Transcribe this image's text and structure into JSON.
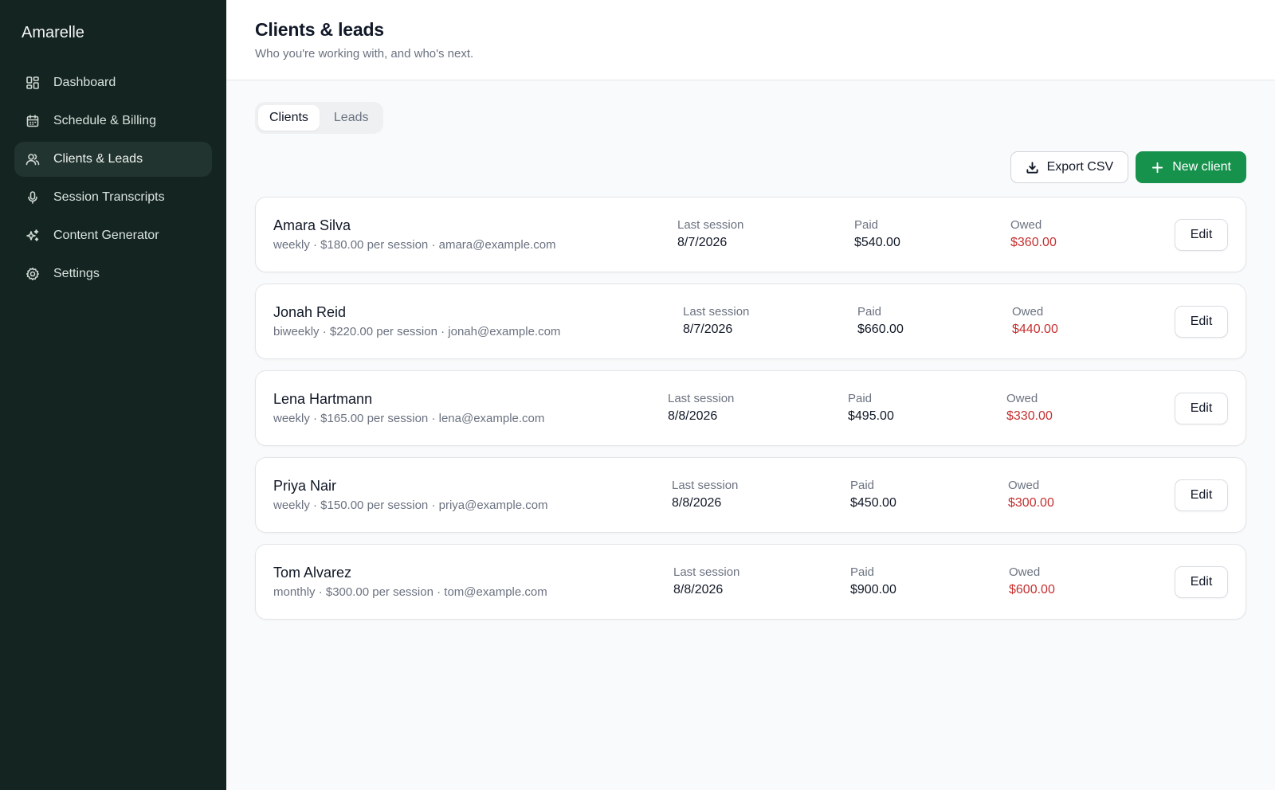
{
  "app": {
    "brand": "Amarelle"
  },
  "sidebar": {
    "items": [
      {
        "label": "Dashboard",
        "icon": "dashboard-icon",
        "active": false
      },
      {
        "label": "Schedule & Billing",
        "icon": "calendar-icon",
        "active": false
      },
      {
        "label": "Clients & Leads",
        "icon": "users-icon",
        "active": true
      },
      {
        "label": "Session Transcripts",
        "icon": "microphone-icon",
        "active": false
      },
      {
        "label": "Content Generator",
        "icon": "sparkles-icon",
        "active": false
      },
      {
        "label": "Settings",
        "icon": "gear-icon",
        "active": false
      }
    ]
  },
  "header": {
    "title": "Clients & leads",
    "subtitle": "Who you're working with, and who's next."
  },
  "tabs": [
    {
      "label": "Clients",
      "active": true
    },
    {
      "label": "Leads",
      "active": false
    }
  ],
  "toolbar": {
    "export_label": "Export CSV",
    "new_label": "New client"
  },
  "columns": {
    "last_session": "Last session",
    "paid": "Paid",
    "owed": "Owed"
  },
  "edit_label": "Edit",
  "clients": [
    {
      "name": "Amara Silva",
      "meta": "weekly · $180.00 per session · amara@example.com",
      "last_session": "8/7/2026",
      "paid": "$540.00",
      "owed": "$360.00"
    },
    {
      "name": "Jonah Reid",
      "meta": "biweekly · $220.00 per session · jonah@example.com",
      "last_session": "8/7/2026",
      "paid": "$660.00",
      "owed": "$440.00"
    },
    {
      "name": "Lena Hartmann",
      "meta": "weekly · $165.00 per session · lena@example.com",
      "last_session": "8/8/2026",
      "paid": "$495.00",
      "owed": "$330.00"
    },
    {
      "name": "Priya Nair",
      "meta": "weekly · $150.00 per session · priya@example.com",
      "last_session": "8/8/2026",
      "paid": "$450.00",
      "owed": "$300.00"
    },
    {
      "name": "Tom Alvarez",
      "meta": "monthly · $300.00 per session · tom@example.com",
      "last_session": "8/8/2026",
      "paid": "$900.00",
      "owed": "$600.00"
    }
  ],
  "colors": {
    "sidebar_bg": "#142420",
    "accent": "#16924d",
    "owed": "#c53030"
  }
}
